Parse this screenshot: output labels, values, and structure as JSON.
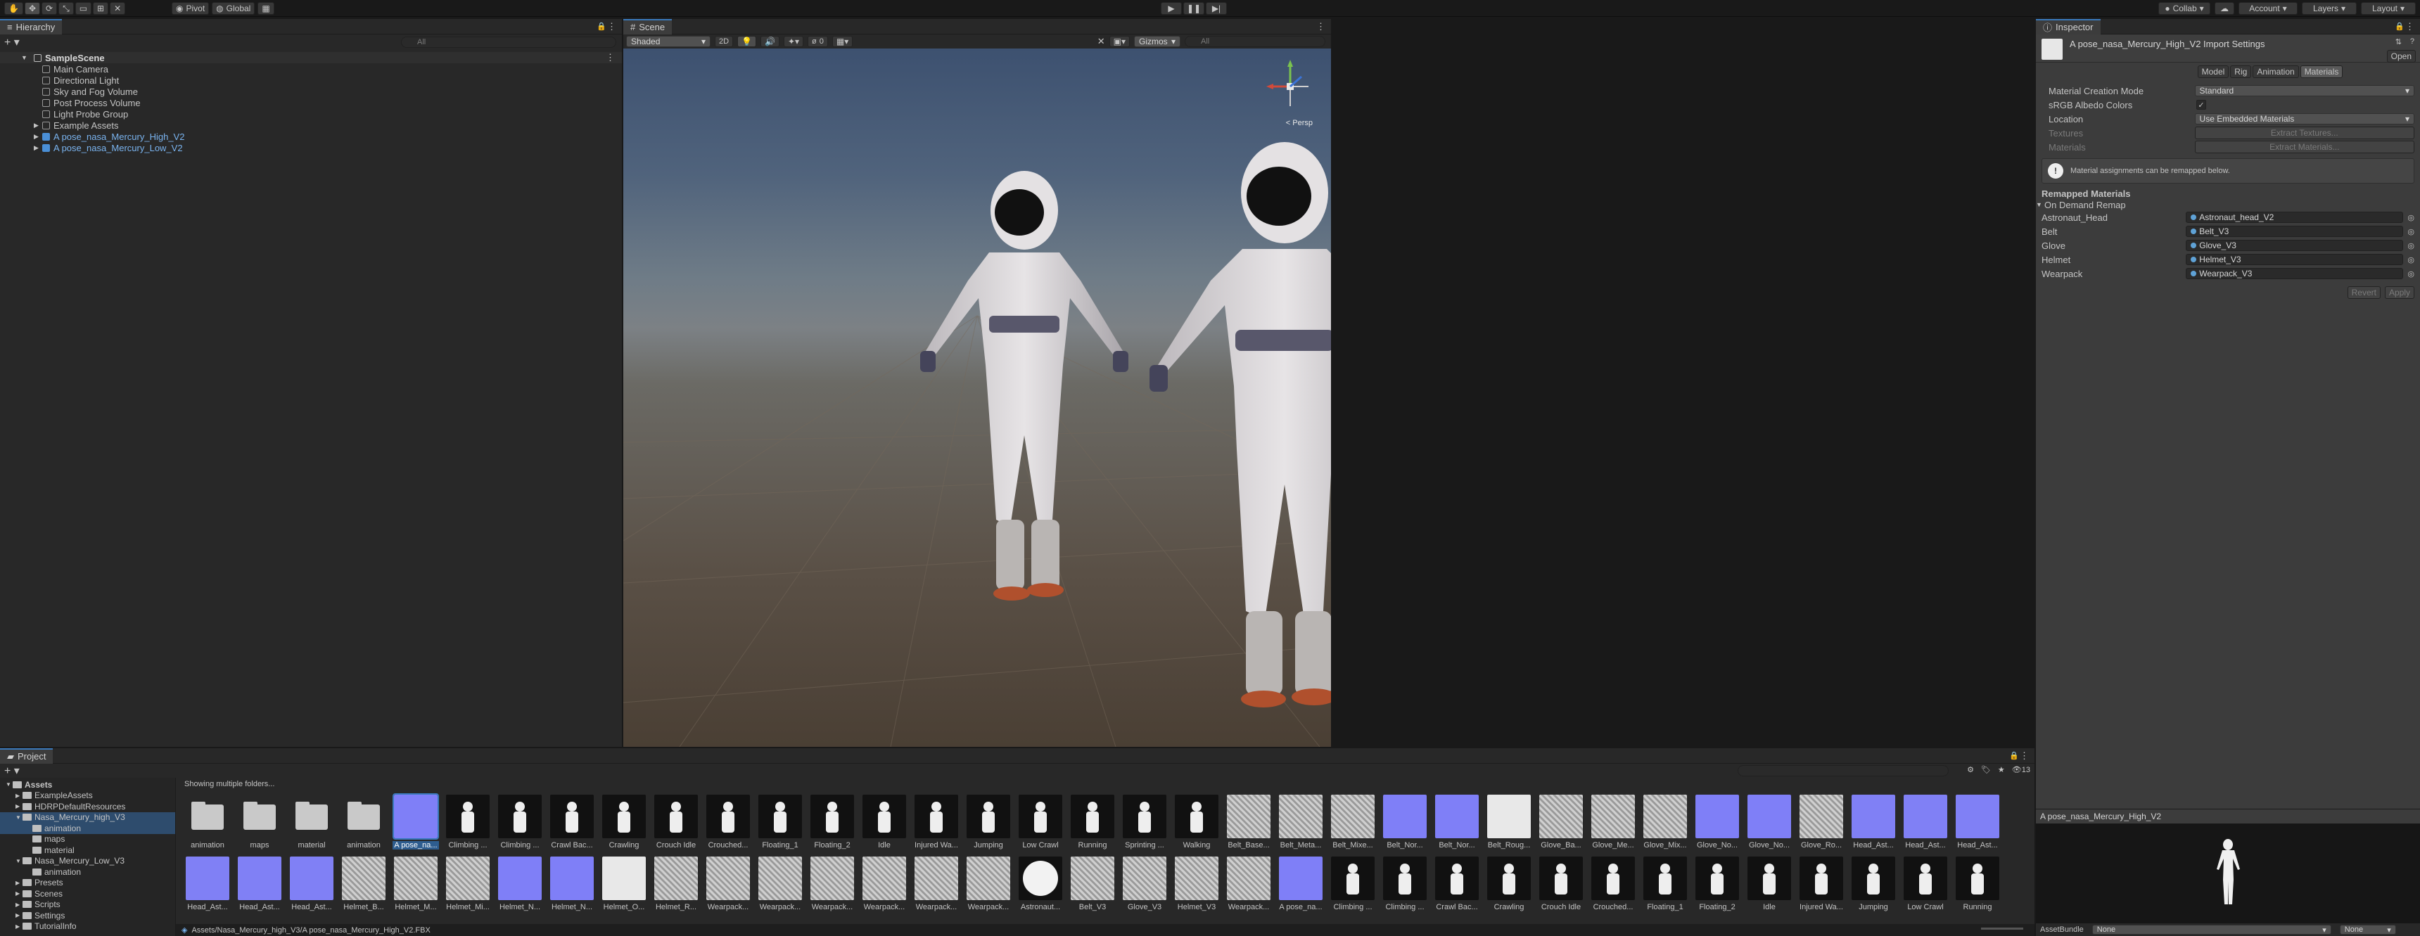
{
  "toolbar": {
    "pivot": "Pivot",
    "global": "Global",
    "collab": "Collab",
    "account": "Account",
    "layers": "Layers",
    "layout": "Layout"
  },
  "hierarchy": {
    "tab": "Hierarchy",
    "search_placeholder": "All",
    "scene": "SampleScene",
    "items": [
      "Main Camera",
      "Directional Light",
      "Sky and Fog Volume",
      "Post Process Volume",
      "Light Probe Group",
      "Example Assets",
      "A pose_nasa_Mercury_High_V2",
      "A pose_nasa_Mercury_Low_V2"
    ]
  },
  "scene": {
    "tab": "Scene",
    "shading": "Shaded",
    "mode2d": "2D",
    "audio_count": "0",
    "gizmos": "Gizmos",
    "search_placeholder": "All",
    "persp": "< Persp"
  },
  "inspector": {
    "tab": "Inspector",
    "title": "A pose_nasa_Mercury_High_V2 Import Settings",
    "open": "Open",
    "tabs": [
      "Model",
      "Rig",
      "Animation",
      "Materials"
    ],
    "props": [
      {
        "label": "Material Creation Mode",
        "value": "Standard"
      },
      {
        "label": "sRGB Albedo Colors",
        "value": "✓"
      },
      {
        "label": "Location",
        "value": "Use Embedded Materials"
      },
      {
        "label": "Textures",
        "value": "Extract Textures..."
      },
      {
        "label": "Materials",
        "value": "Extract Materials..."
      }
    ],
    "info": "Material assignments can be remapped below.",
    "remapped_header": "Remapped Materials",
    "on_demand": "On Demand Remap",
    "remaps": [
      {
        "label": "Astronaut_Head",
        "value": "Astronaut_head_V2"
      },
      {
        "label": "Belt",
        "value": "Belt_V3"
      },
      {
        "label": "Glove",
        "value": "Glove_V3"
      },
      {
        "label": "Helmet",
        "value": "Helmet_V3"
      },
      {
        "label": "Wearpack",
        "value": "Wearpack_V3"
      }
    ],
    "revert": "Revert",
    "apply": "Apply",
    "preview_title": "A pose_nasa_Mercury_High_V2",
    "asset_bundle": "AssetBundle",
    "bundle_none": "None",
    "variant_none": "None"
  },
  "project": {
    "tab": "Project",
    "showing": "Showing multiple folders...",
    "count": "13",
    "tree": [
      {
        "label": "Assets",
        "depth": 0
      },
      {
        "label": "ExampleAssets",
        "depth": 1
      },
      {
        "label": "HDRPDefaultResources",
        "depth": 1
      },
      {
        "label": "Nasa_Mercury_high_V3",
        "depth": 1
      },
      {
        "label": "animation",
        "depth": 2
      },
      {
        "label": "maps",
        "depth": 2
      },
      {
        "label": "material",
        "depth": 2
      },
      {
        "label": "Nasa_Mercury_Low_V3",
        "depth": 1
      },
      {
        "label": "animation",
        "depth": 2
      },
      {
        "label": "Presets",
        "depth": 1
      },
      {
        "label": "Scenes",
        "depth": 1
      },
      {
        "label": "Scripts",
        "depth": 1
      },
      {
        "label": "Settings",
        "depth": 1
      },
      {
        "label": "TutorialInfo",
        "depth": 1
      }
    ],
    "row1": [
      "animation",
      "maps",
      "material",
      "animation",
      "A pose_na...",
      "Climbing ...",
      "Climbing ...",
      "Crawl Bac...",
      "Crawling",
      "Crouch Idle",
      "Crouched...",
      "Floating_1",
      "Floating_2",
      "Idle",
      "Injured Wa...",
      "Jumping",
      "Low Crawl",
      "Running",
      "Sprinting ...",
      "Walking",
      "Belt_Base...",
      "Belt_Meta...",
      "Belt_Mixe...",
      "Belt_Nor...",
      "Belt_Nor...",
      "Belt_Roug...",
      "Glove_Ba...",
      "Glove_Me...",
      "Glove_Mix...",
      "Glove_No...",
      "Glove_No...",
      "Glove_Ro...",
      "Head_Ast...",
      "Head_Ast...",
      "Head_Ast..."
    ],
    "row2": [
      "Head_Ast...",
      "Head_Ast...",
      "Head_Ast...",
      "Helmet_B...",
      "Helmet_M...",
      "Helmet_Mi...",
      "Helmet_N...",
      "Helmet_N...",
      "Helmet_O...",
      "Helmet_R...",
      "Wearpack...",
      "Wearpack...",
      "Wearpack...",
      "Wearpack...",
      "Wearpack...",
      "Wearpack...",
      "Astronaut...",
      "Belt_V3",
      "Glove_V3",
      "Helmet_V3",
      "Wearpack...",
      "A pose_na...",
      "Climbing ...",
      "Climbing ...",
      "Crawl Bac...",
      "Crawling",
      "Crouch Idle",
      "Crouched...",
      "Floating_1",
      "Floating_2",
      "Idle",
      "Injured Wa...",
      "Jumping",
      "Low Crawl",
      "Running"
    ],
    "path": "Assets/Nasa_Mercury_high_V3/A pose_nasa_Mercury_High_V2.FBX"
  }
}
